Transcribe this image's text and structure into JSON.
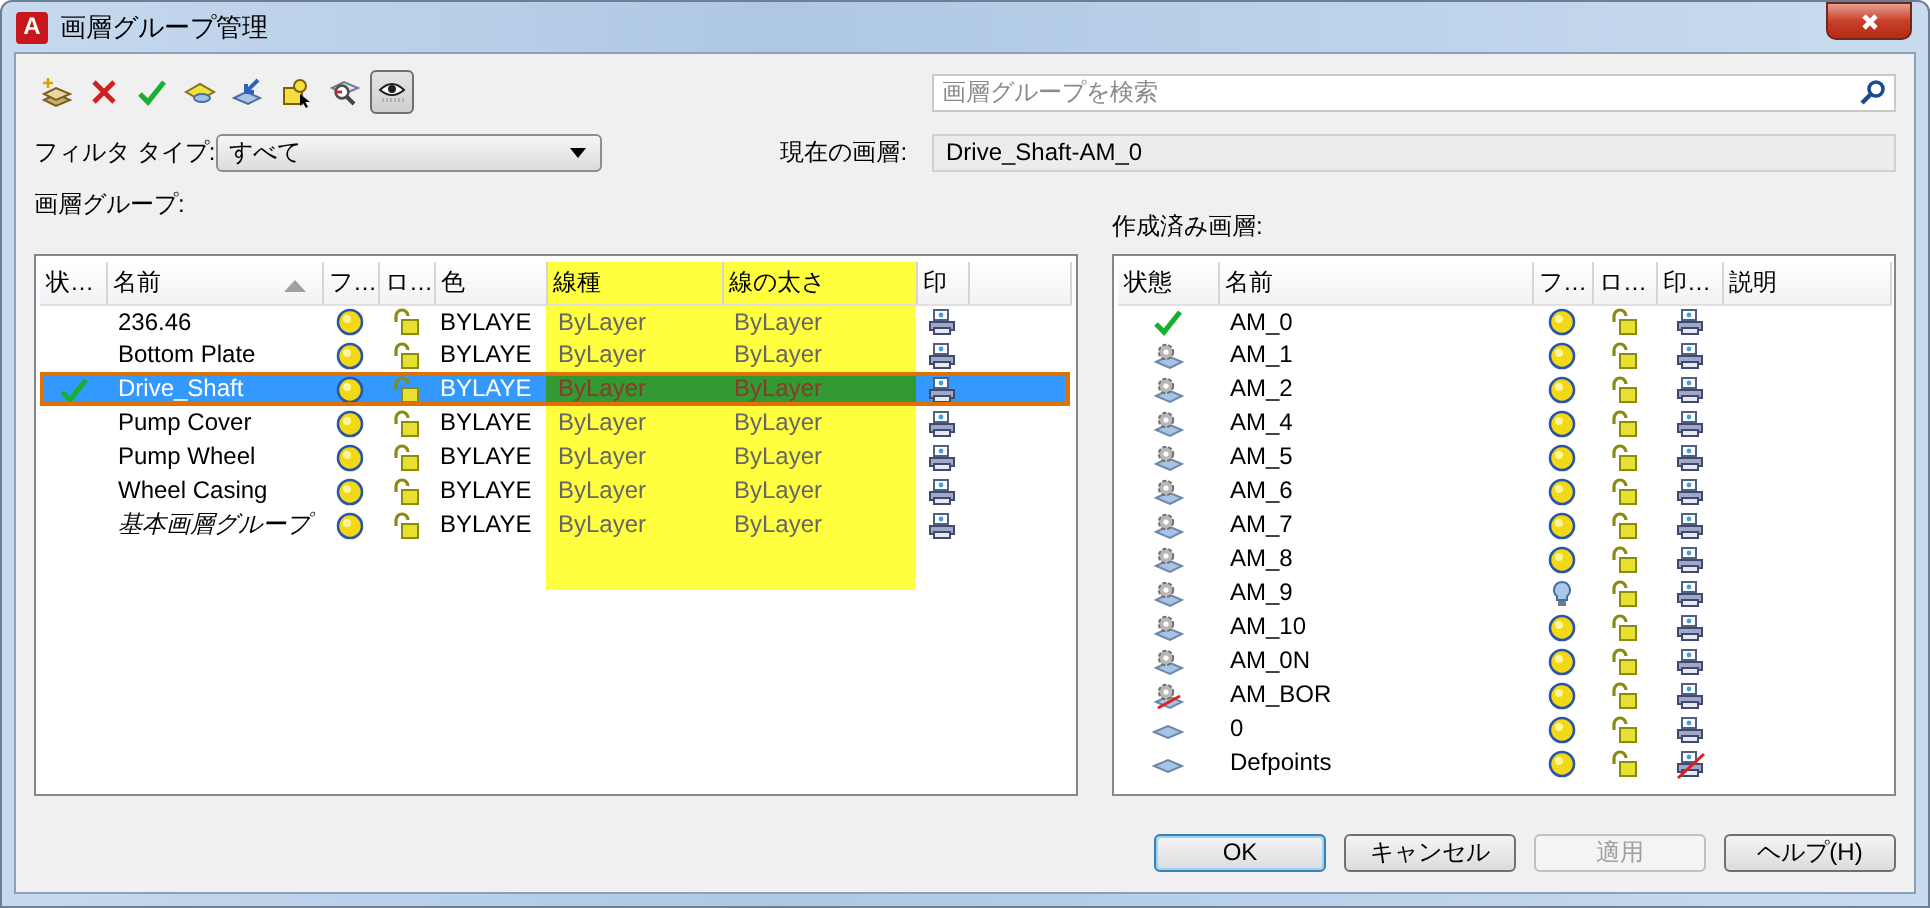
{
  "window": {
    "app_icon_letter": "A",
    "title": "画層グループ管理"
  },
  "toolbar": [
    {
      "kind": "new_group",
      "pressed": false
    },
    {
      "kind": "delete",
      "pressed": false
    },
    {
      "kind": "set_current",
      "pressed": false
    },
    {
      "kind": "layer",
      "pressed": false
    },
    {
      "kind": "import",
      "pressed": false
    },
    {
      "kind": "lock",
      "pressed": false
    },
    {
      "kind": "find",
      "pressed": false
    },
    {
      "kind": "visibility",
      "pressed": true
    }
  ],
  "search": {
    "placeholder": "画層グループを検索"
  },
  "filter": {
    "label": "フィルタ タイプ:",
    "value": "すべて"
  },
  "current_layer": {
    "label": "現在の画層:",
    "value": "Drive_Shaft-AM_0"
  },
  "groups": {
    "label": "画層グループ:",
    "columns": [
      {
        "label": "状…",
        "highlighted": false
      },
      {
        "label": "名前",
        "highlighted": false,
        "sorted": true
      },
      {
        "label": "フ…",
        "highlighted": false
      },
      {
        "label": "ロ…",
        "highlighted": false
      },
      {
        "label": "色",
        "highlighted": false
      },
      {
        "label": "線種",
        "highlighted": true
      },
      {
        "label": "線の太さ",
        "highlighted": true
      },
      {
        "label": "印",
        "highlighted": false
      }
    ],
    "rows": [
      {
        "current": false,
        "name": "236.46",
        "italic": false,
        "thawed": true,
        "color_value": "BYLAYE",
        "linetype": "ByLayer",
        "lineweight": "ByLayer",
        "plot": true,
        "selected": false
      },
      {
        "current": false,
        "name": "Bottom Plate",
        "italic": false,
        "thawed": true,
        "color_value": "BYLAYE",
        "linetype": "ByLayer",
        "lineweight": "ByLayer",
        "plot": true,
        "selected": false
      },
      {
        "current": true,
        "name": "Drive_Shaft",
        "italic": false,
        "thawed": true,
        "color_value": "BYLAYE",
        "linetype": "ByLayer",
        "lineweight": "ByLayer",
        "plot": true,
        "selected": true
      },
      {
        "current": false,
        "name": "Pump Cover",
        "italic": false,
        "thawed": true,
        "color_value": "BYLAYE",
        "linetype": "ByLayer",
        "lineweight": "ByLayer",
        "plot": true,
        "selected": false
      },
      {
        "current": false,
        "name": "Pump Wheel",
        "italic": false,
        "thawed": true,
        "color_value": "BYLAYE",
        "linetype": "ByLayer",
        "lineweight": "ByLayer",
        "plot": true,
        "selected": false
      },
      {
        "current": false,
        "name": "Wheel Casing",
        "italic": false,
        "thawed": true,
        "color_value": "BYLAYE",
        "linetype": "ByLayer",
        "lineweight": "ByLayer",
        "plot": true,
        "selected": false
      },
      {
        "current": false,
        "name": "基本画層グループ",
        "italic": true,
        "thawed": true,
        "color_value": "BYLAYE",
        "linetype": "ByLayer",
        "lineweight": "ByLayer",
        "plot": true,
        "selected": false
      }
    ]
  },
  "layers": {
    "label": "作成済み画層:",
    "columns": [
      {
        "label": "状態"
      },
      {
        "label": "名前"
      },
      {
        "label": "フ…"
      },
      {
        "label": "ロ…"
      },
      {
        "label": "印…"
      },
      {
        "label": "説明"
      }
    ],
    "rows": [
      {
        "kind": "current",
        "name": "AM_0",
        "thawed": true,
        "plot": true
      },
      {
        "kind": "layer",
        "name": "AM_1",
        "thawed": true,
        "plot": true
      },
      {
        "kind": "layer",
        "name": "AM_2",
        "thawed": true,
        "plot": true
      },
      {
        "kind": "layer",
        "name": "AM_4",
        "thawed": true,
        "plot": true
      },
      {
        "kind": "layer",
        "name": "AM_5",
        "thawed": true,
        "plot": true
      },
      {
        "kind": "layer",
        "name": "AM_6",
        "thawed": true,
        "plot": true
      },
      {
        "kind": "layer",
        "name": "AM_7",
        "thawed": true,
        "plot": true
      },
      {
        "kind": "layer",
        "name": "AM_8",
        "thawed": true,
        "plot": true
      },
      {
        "kind": "layer",
        "name": "AM_9",
        "thawed": false,
        "plot": true
      },
      {
        "kind": "layer",
        "name": "AM_10",
        "thawed": true,
        "plot": true
      },
      {
        "kind": "layer",
        "name": "AM_0N",
        "thawed": true,
        "plot": true
      },
      {
        "kind": "layer_unused",
        "name": "AM_BOR",
        "thawed": true,
        "plot": true
      },
      {
        "kind": "plain",
        "name": "0",
        "thawed": true,
        "plot": true
      },
      {
        "kind": "plain",
        "name": "Defpoints",
        "thawed": true,
        "plot": false
      }
    ]
  },
  "buttons": [
    {
      "label": "OK",
      "default": true,
      "disabled": false
    },
    {
      "label": "キャンセル",
      "default": false,
      "disabled": false
    },
    {
      "label": "適用",
      "default": false,
      "disabled": true
    },
    {
      "label": "ヘルプ(H)",
      "default": false,
      "disabled": false
    }
  ]
}
